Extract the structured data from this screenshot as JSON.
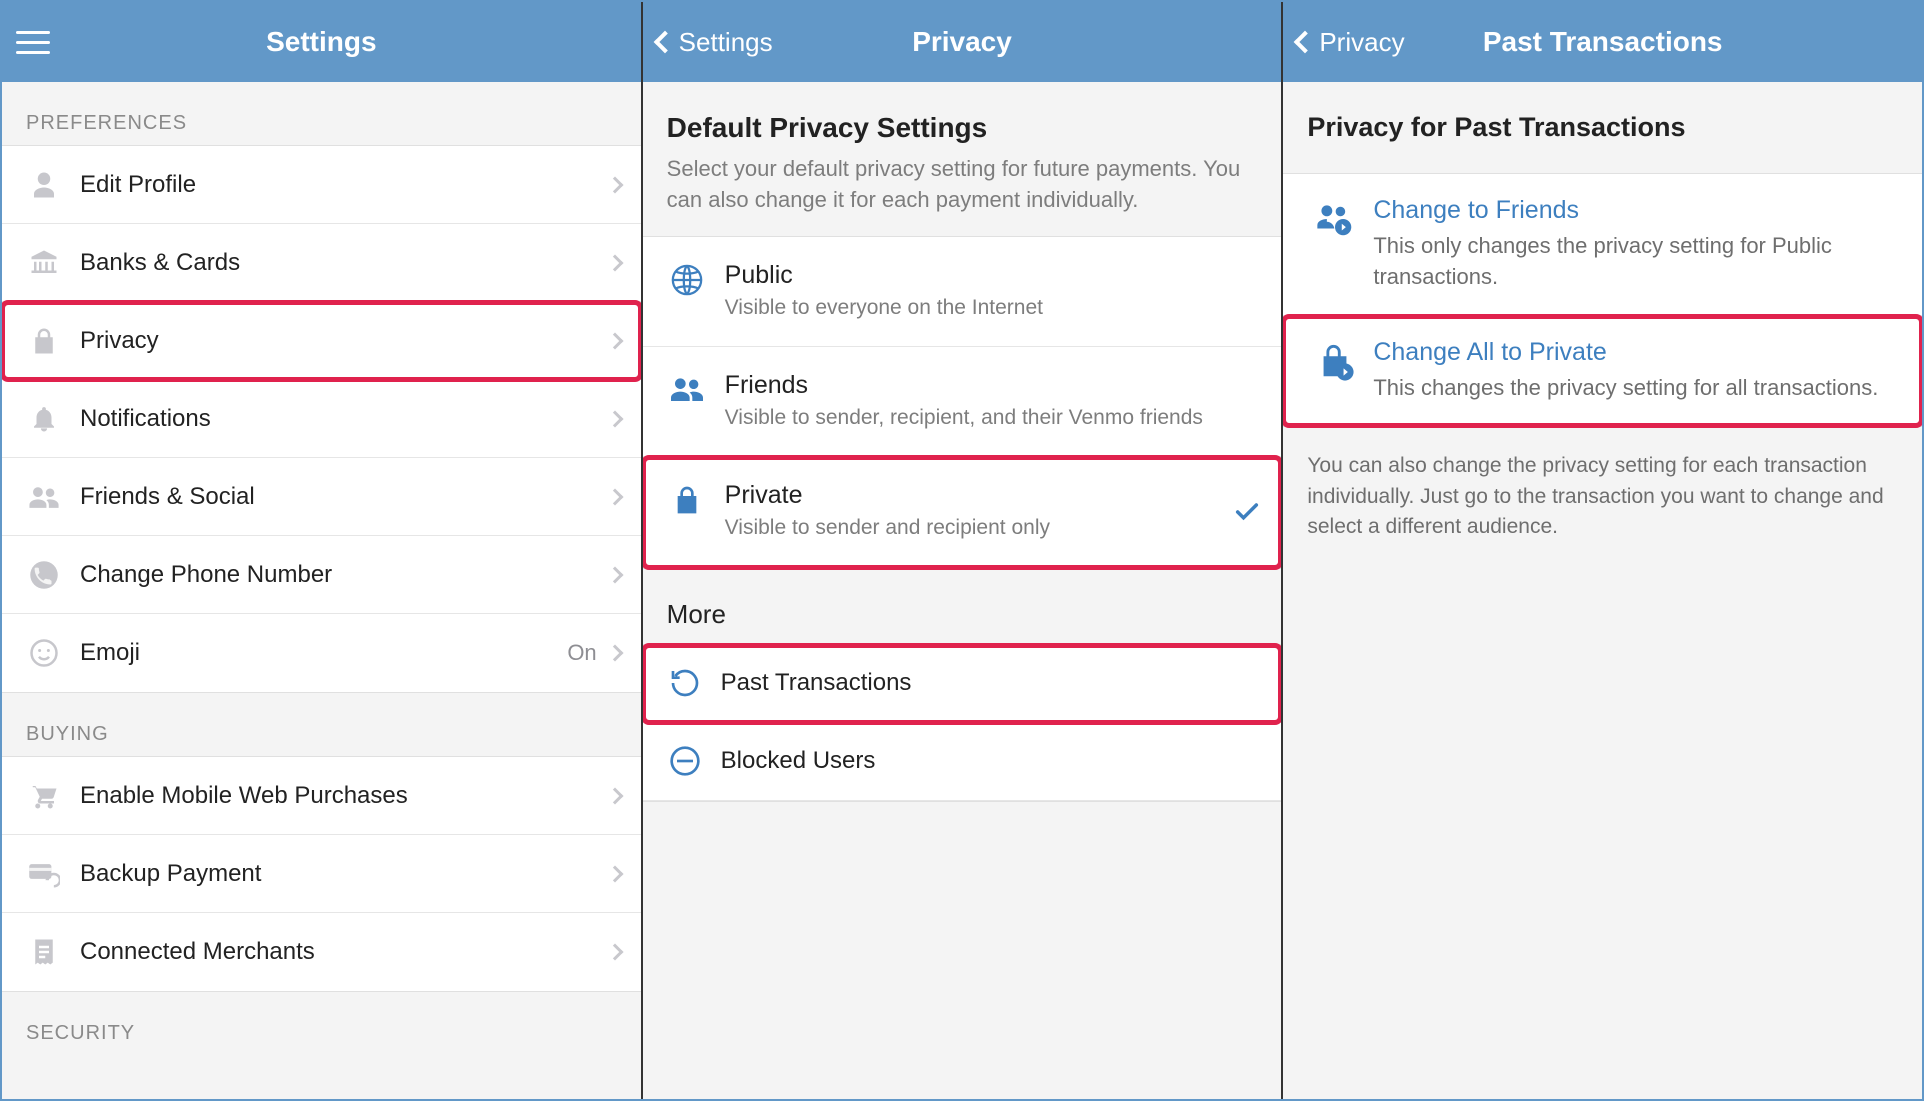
{
  "colors": {
    "brand": "#6298c8",
    "highlight": "#e0224d",
    "link": "#3d7fbf"
  },
  "panel1": {
    "title": "Settings",
    "sections": {
      "preferences": {
        "header": "PREFERENCES",
        "items": [
          {
            "label": "Edit Profile"
          },
          {
            "label": "Banks & Cards"
          },
          {
            "label": "Privacy"
          },
          {
            "label": "Notifications"
          },
          {
            "label": "Friends & Social"
          },
          {
            "label": "Change Phone Number"
          },
          {
            "label": "Emoji",
            "value": "On"
          }
        ]
      },
      "buying": {
        "header": "BUYING",
        "items": [
          {
            "label": "Enable Mobile Web Purchases"
          },
          {
            "label": "Backup Payment"
          },
          {
            "label": "Connected Merchants"
          }
        ]
      },
      "security": {
        "header": "SECURITY"
      }
    }
  },
  "panel2": {
    "back": "Settings",
    "title": "Privacy",
    "intro_title": "Default Privacy Settings",
    "intro_sub": "Select your default privacy setting for future payments. You can also change it for each payment individually.",
    "options": [
      {
        "title": "Public",
        "sub": "Visible to everyone on the Internet"
      },
      {
        "title": "Friends",
        "sub": "Visible to sender, recipient, and their Venmo friends"
      },
      {
        "title": "Private",
        "sub": "Visible to sender and recipient only"
      }
    ],
    "more_header": "More",
    "more_items": [
      {
        "label": "Past Transactions"
      },
      {
        "label": "Blocked Users"
      }
    ]
  },
  "panel3": {
    "back": "Privacy",
    "title": "Past Transactions",
    "heading": "Privacy for Past Transactions",
    "actions": [
      {
        "title": "Change to Friends",
        "sub": "This only changes the privacy setting for Public transactions."
      },
      {
        "title": "Change All to Private",
        "sub": "This changes the privacy setting for all transactions."
      }
    ],
    "footer": "You can also change the privacy setting for each transaction individually. Just go to the transaction you want to change and select a different audience."
  }
}
